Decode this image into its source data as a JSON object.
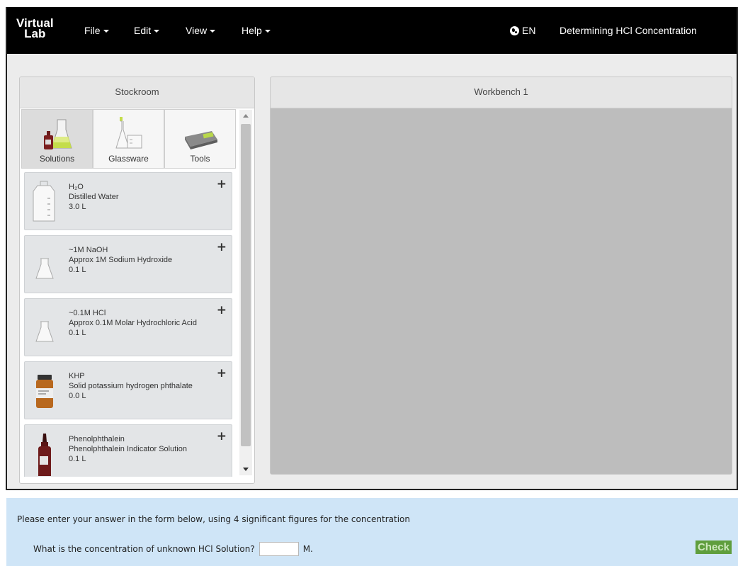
{
  "navbar": {
    "brand_line1": "Virtual",
    "brand_line2": "Lab",
    "menus": [
      "File",
      "Edit",
      "View",
      "Help"
    ],
    "language": "EN",
    "title": "Determining HCl Concentration"
  },
  "stockroom": {
    "title": "Stockroom",
    "tabs": [
      {
        "label": "Solutions",
        "icon": "solutions-icon",
        "active": true
      },
      {
        "label": "Glassware",
        "icon": "glassware-icon",
        "active": false
      },
      {
        "label": "Tools",
        "icon": "tools-icon",
        "active": false
      }
    ],
    "items": [
      {
        "name_html": "H₂O",
        "name": "H₂O",
        "desc": "Distilled Water",
        "amount": "3.0 L",
        "icon": "water-jug-icon"
      },
      {
        "name": "~1M NaOH",
        "desc": "Approx 1M Sodium Hydroxide",
        "amount": "0.1 L",
        "icon": "flask-icon"
      },
      {
        "name": "~0.1M HCl",
        "desc": "Approx 0.1M Molar Hydrochloric Acid",
        "amount": "0.1 L",
        "icon": "flask-icon"
      },
      {
        "name": "KHP",
        "desc": "Solid potassium hydrogen phthalate",
        "amount": "0.0 L",
        "icon": "powder-jar-icon"
      },
      {
        "name": "Phenolphthalein",
        "desc": "Phenolphthalein Indicator Solution",
        "amount": "0.1 L",
        "icon": "dropper-bottle-icon"
      }
    ],
    "add_symbol": "+"
  },
  "workbench": {
    "title": "Workbench 1"
  },
  "answer": {
    "instruction": "Please enter your answer in the form below, using 4 significant figures for the concentration",
    "question": "What is the concentration of unknown HCl Solution?",
    "unit": "M.",
    "input_value": "",
    "check_label": "Check"
  },
  "colors": {
    "navbar_bg": "#000000",
    "workbench_bg": "#bdbdbd",
    "answer_bg": "#cfe5f7",
    "check_bg": "#5f9e3d"
  }
}
